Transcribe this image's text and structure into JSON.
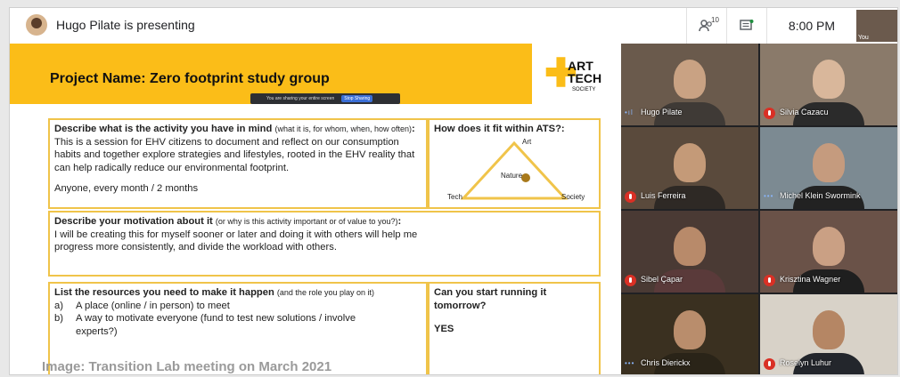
{
  "topbar": {
    "presenting_text": "Hugo Pilate is presenting",
    "participant_count": "10",
    "time": "8:00 PM",
    "self_label": "You"
  },
  "slide": {
    "project_name": "Project Name:  Zero footprint study group",
    "sharing_bar": {
      "message": "You are sharing your entire screen",
      "stop_label": "Stop Sharing"
    },
    "logo": {
      "line1": "ART",
      "line2": "TECH",
      "line3": "SOCIETY"
    },
    "activity": {
      "heading": "Describe what is the activity you have in mind",
      "heading_note": "(what it is, for whom, when, how often)",
      "heading_colon": ":",
      "body": "This is a session for EHV citizens to document and reflect on our consumption habits and together explore strategies and lifestyles, rooted in the EHV reality that can help radically reduce our environmental footprint.",
      "frequency": "Anyone, every month / 2 months"
    },
    "ats": {
      "heading": "How does it fit within ATS?:",
      "art": "Art",
      "nature": "Nature",
      "tech": "Tech",
      "society": "Society"
    },
    "motivation": {
      "heading": "Describe your motivation about it",
      "heading_note": "(or why is this activity important or of value to you?)",
      "heading_colon": ":",
      "body": "I will be creating this for myself sooner or later and doing it with others will help me progress more consistently, and divide the workload with others."
    },
    "resources": {
      "heading": "List the resources you need to make it happen",
      "heading_note": "(and the role you play on it)",
      "items": [
        {
          "marker": "a)",
          "text": "A place (online / in person) to meet"
        },
        {
          "marker": "b)",
          "text": "A way to motivate everyone (fund to test new solutions / involve experts?)"
        }
      ]
    },
    "start": {
      "heading": "Can you start running it tomorrow?",
      "answer": "YES"
    }
  },
  "participants": [
    {
      "name": "Hugo Pilate",
      "status": "speaking"
    },
    {
      "name": "Silvia Cazacu",
      "status": "muted"
    },
    {
      "name": "Luis Ferreira",
      "status": "muted"
    },
    {
      "name": "Michel Klein Swormink",
      "status": "speaking"
    },
    {
      "name": "Sibel Çapar",
      "status": "muted"
    },
    {
      "name": "Krisztina Wagner",
      "status": "muted"
    },
    {
      "name": "Chris Dierickx",
      "status": "speaking"
    },
    {
      "name": "Roselyn Luhur",
      "status": "muted"
    }
  ],
  "caption": "Image: Transition Lab meeting on March 2021",
  "colors": {
    "accent_yellow": "#fbbd18",
    "box_border": "#f0c44a",
    "muted_red": "#d93025"
  }
}
